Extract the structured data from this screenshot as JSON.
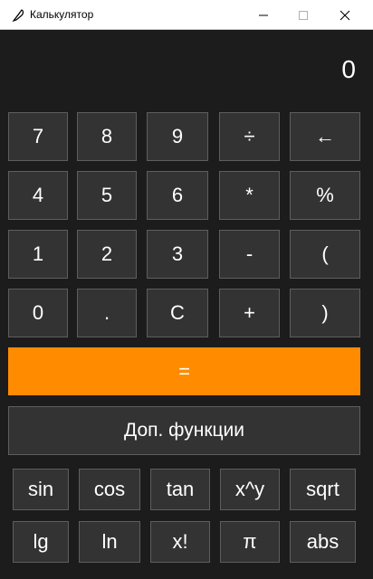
{
  "window": {
    "title": "Калькулятор",
    "icon": "feather-icon",
    "controls": [
      "minimize-icon",
      "maximize-icon",
      "close-icon"
    ]
  },
  "display": {
    "value": "0"
  },
  "keypad": [
    [
      "7",
      "8",
      "9",
      "÷",
      "←"
    ],
    [
      "4",
      "5",
      "6",
      "*",
      "%"
    ],
    [
      "1",
      "2",
      "3",
      "-",
      "("
    ],
    [
      "0",
      ".",
      "C",
      "+",
      ")"
    ]
  ],
  "equals_label": "=",
  "extra_label": "Доп. функции",
  "functions": [
    [
      "sin",
      "cos",
      "tan",
      "x^y",
      "sqrt"
    ],
    [
      "lg",
      "ln",
      "x!",
      "π",
      "abs"
    ]
  ],
  "colors": {
    "background": "#1c1c1c",
    "button": "#333333",
    "button_border": "#5e5e5e",
    "accent": "#ff8c00",
    "text": "#ffffff"
  }
}
